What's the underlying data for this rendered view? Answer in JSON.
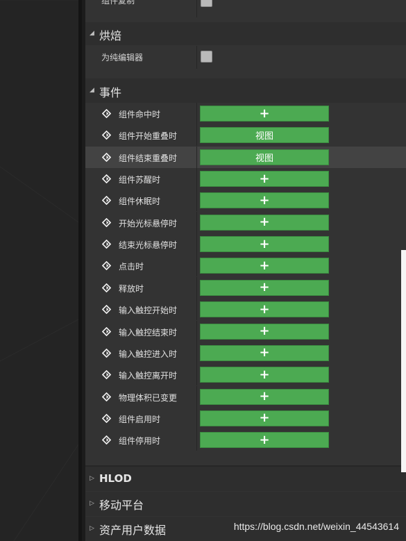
{
  "top_partial_label": "组件复制",
  "categories": {
    "bake": {
      "title": "烘焙",
      "prop_label": "为纯编辑器"
    },
    "events": {
      "title": "事件"
    },
    "hlod": {
      "title": "HLOD"
    },
    "mobile": {
      "title": "移动平台"
    },
    "asset_user_data": {
      "title": "资产用户数据"
    }
  },
  "events": [
    {
      "label": "组件命中时",
      "button": "+"
    },
    {
      "label": "组件开始重叠时",
      "button": "视图"
    },
    {
      "label": "组件结束重叠时",
      "button": "视图"
    },
    {
      "label": "组件苏醒时",
      "button": "+"
    },
    {
      "label": "组件休眠时",
      "button": "+"
    },
    {
      "label": "开始光标悬停时",
      "button": "+"
    },
    {
      "label": "结束光标悬停时",
      "button": "+"
    },
    {
      "label": "点击时",
      "button": "+"
    },
    {
      "label": "释放时",
      "button": "+"
    },
    {
      "label": "输入触控开始时",
      "button": "+"
    },
    {
      "label": "输入触控结束时",
      "button": "+"
    },
    {
      "label": "输入触控进入时",
      "button": "+"
    },
    {
      "label": "输入触控离开时",
      "button": "+"
    },
    {
      "label": "物理体积已变更",
      "button": "+"
    },
    {
      "label": "组件启用时",
      "button": "+"
    },
    {
      "label": "组件停用时",
      "button": "+"
    }
  ],
  "watermark": "https://blog.csdn.net/weixin_44543614",
  "colors": {
    "button_green": "#4caa52",
    "panel_bg": "#333333",
    "category_bg": "#2e2e2e"
  }
}
